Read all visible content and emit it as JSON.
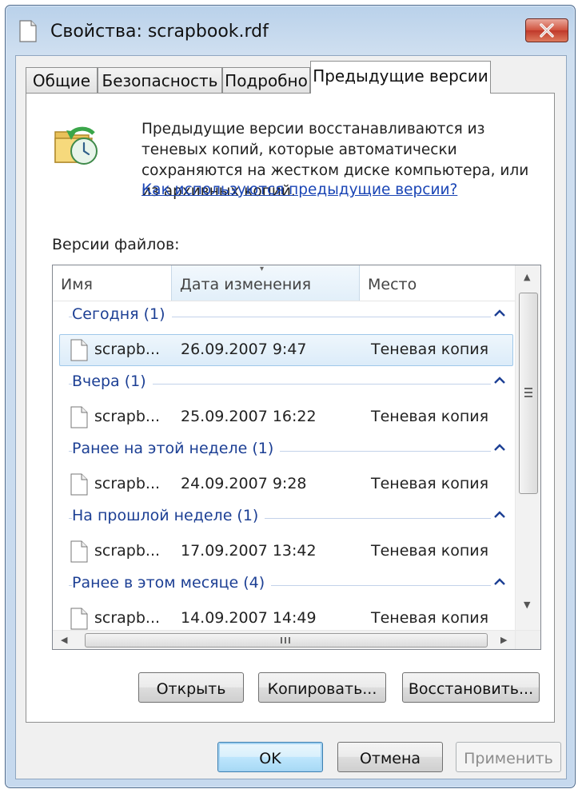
{
  "window": {
    "title": "Свойства: scrapbook.rdf"
  },
  "tabs": [
    {
      "label": "Общие"
    },
    {
      "label": "Безопасность"
    },
    {
      "label": "Подробно"
    },
    {
      "label": "Предыдущие версии",
      "active": true
    }
  ],
  "info": {
    "text": "Предыдущие версии восстанавливаются из теневых копий, которые автоматически сохраняются на жестком диске компьютера, или из архивных копий.",
    "link": "Как используются предыдущие версии?"
  },
  "file_versions": {
    "label": "Версии файлов:",
    "columns": [
      "Имя",
      "Дата изменения",
      "Место"
    ],
    "groups": [
      {
        "label": "Сегодня (1)",
        "rows": [
          {
            "name": "scrapb...",
            "date": "26.09.2007 9:47",
            "location": "Теневая копия",
            "selected": true
          }
        ]
      },
      {
        "label": "Вчера (1)",
        "rows": [
          {
            "name": "scrapb...",
            "date": "25.09.2007 16:22",
            "location": "Теневая копия"
          }
        ]
      },
      {
        "label": "Ранее на этой неделе (1)",
        "rows": [
          {
            "name": "scrapb...",
            "date": "24.09.2007 9:28",
            "location": "Теневая копия"
          }
        ]
      },
      {
        "label": "На прошлой неделе (1)",
        "rows": [
          {
            "name": "scrapb...",
            "date": "17.09.2007 13:42",
            "location": "Теневая копия"
          }
        ]
      },
      {
        "label": "Ранее в этом месяце (4)",
        "rows": [
          {
            "name": "scrapb...",
            "date": "14.09.2007 14:49",
            "location": "Теневая копия"
          }
        ]
      }
    ]
  },
  "actions": {
    "open": "Открыть",
    "copy": "Копировать...",
    "restore": "Восстановить..."
  },
  "dialog_buttons": {
    "ok": "OK",
    "cancel": "Отмена",
    "apply": "Применить"
  },
  "colors": {
    "group_header": "#1c3f94",
    "link": "#1a45b5",
    "selection": "#dcecf9"
  }
}
